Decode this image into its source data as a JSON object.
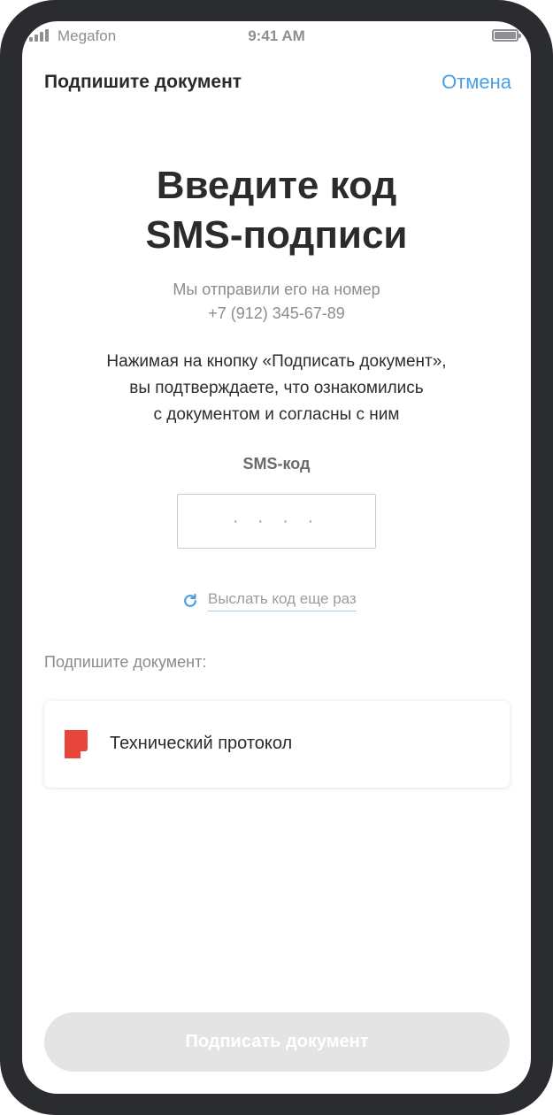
{
  "status_bar": {
    "carrier": "Megafon",
    "time": "9:41 AM"
  },
  "header": {
    "title": "Подпишите документ",
    "cancel_label": "Отмена"
  },
  "main": {
    "heading_line1": "Введите код",
    "heading_line2": "SMS-подписи",
    "sent_line1": "Мы отправили его на номер",
    "sent_line2": "+7 (912) 345-67-89",
    "consent_line1": "Нажимая на кнопку «Подписать документ»,",
    "consent_line2": "вы подтверждаете, что ознакомились",
    "consent_line3": "с документом и согласны с ним",
    "sms_label": "SMS-код",
    "sms_placeholder": "· · · ·",
    "resend_label": "Выслать код еще раз",
    "documents_label": "Подпишите документ:",
    "document_name": "Технический протокол",
    "sign_button_label": "Подписать документ"
  },
  "icons": {
    "signal": "signal-icon",
    "battery": "battery-icon",
    "resend": "refresh-icon",
    "document": "pdf-document-icon"
  },
  "colors": {
    "accent": "#4a9fe3",
    "document_icon": "#e8453c",
    "disabled_button": "#e4e4e4"
  }
}
